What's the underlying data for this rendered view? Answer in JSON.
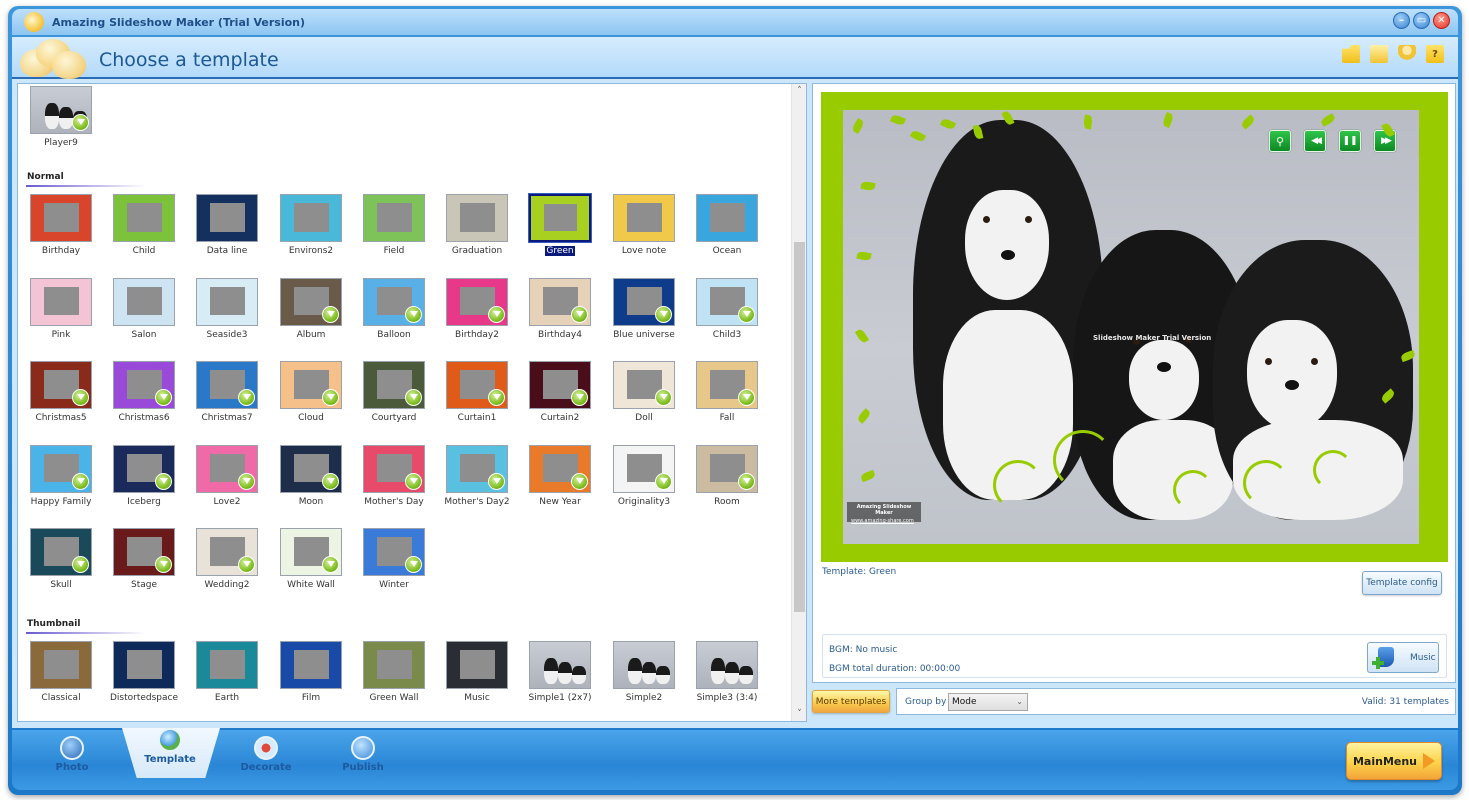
{
  "window": {
    "title": "Amazing Slideshow Maker (Trial Version)",
    "controls": {
      "minimize": "–",
      "maximize": "▭",
      "close": "✕"
    }
  },
  "header": {
    "title": "Choose a template",
    "tools": [
      {
        "name": "open-folder-icon",
        "glyph": ""
      },
      {
        "name": "save-icon",
        "glyph": ""
      },
      {
        "name": "user-icon",
        "glyph": ""
      },
      {
        "name": "help-icon",
        "glyph": "?"
      }
    ]
  },
  "templates": {
    "top": [
      {
        "label": "Player9",
        "style": "dogs",
        "download": true
      }
    ],
    "sections": [
      {
        "title": "Normal",
        "items": [
          {
            "label": "Birthday",
            "bg": "#d8452a",
            "download": false
          },
          {
            "label": "Child",
            "bg": "#7cc23a",
            "download": false
          },
          {
            "label": "Data line",
            "bg": "#14305e",
            "download": false
          },
          {
            "label": "Environs2",
            "bg": "#4ab8d8",
            "download": false
          },
          {
            "label": "Field",
            "bg": "#7ec25a",
            "download": false
          },
          {
            "label": "Graduation",
            "bg": "#c9c6b8",
            "download": false
          },
          {
            "label": "Green",
            "bg": "#a8d020",
            "download": false,
            "selected": true
          },
          {
            "label": "Love note",
            "bg": "#f0c84a",
            "download": false
          },
          {
            "label": "Ocean",
            "bg": "#3aa6de",
            "download": false
          },
          {
            "label": "Pink",
            "bg": "#f2c4d4",
            "download": false
          },
          {
            "label": "Salon",
            "bg": "#cfe4f2",
            "download": false
          },
          {
            "label": "Seaside3",
            "bg": "#d8ecf6",
            "download": false
          },
          {
            "label": "Album",
            "bg": "#6a5a4a",
            "download": true
          },
          {
            "label": "Balloon",
            "bg": "#58b0e6",
            "download": true
          },
          {
            "label": "Birthday2",
            "bg": "#e8388a",
            "download": true
          },
          {
            "label": "Birthday4",
            "bg": "#e6d2b8",
            "download": true
          },
          {
            "label": "Blue universe",
            "bg": "#0e3c8a",
            "download": true
          },
          {
            "label": "Child3",
            "bg": "#bfe2f4",
            "download": true
          },
          {
            "label": "Christmas5",
            "bg": "#8a2a1a",
            "download": true
          },
          {
            "label": "Christmas6",
            "bg": "#9a4ad8",
            "download": true
          },
          {
            "label": "Christmas7",
            "bg": "#2a78c8",
            "download": true
          },
          {
            "label": "Cloud",
            "bg": "#f6c08a",
            "download": true
          },
          {
            "label": "Courtyard",
            "bg": "#4a5a3a",
            "download": true
          },
          {
            "label": "Curtain1",
            "bg": "#e05a1a",
            "download": true
          },
          {
            "label": "Curtain2",
            "bg": "#4a0e1a",
            "download": true
          },
          {
            "label": "Doll",
            "bg": "#efe6d8",
            "download": true
          },
          {
            "label": "Fall",
            "bg": "#e8c88a",
            "download": true
          },
          {
            "label": "Happy Family",
            "bg": "#4ab4e8",
            "download": true
          },
          {
            "label": "Iceberg",
            "bg": "#1a2a5a",
            "download": true
          },
          {
            "label": "Love2",
            "bg": "#f06aa8",
            "download": true
          },
          {
            "label": "Moon",
            "bg": "#1e2e4a",
            "download": true
          },
          {
            "label": "Mother's Day",
            "bg": "#e84a6a",
            "download": true
          },
          {
            "label": "Mother's Day2",
            "bg": "#5ac0e0",
            "download": true
          },
          {
            "label": "New Year",
            "bg": "#e87a2a",
            "download": true
          },
          {
            "label": "Originality3",
            "bg": "#f4f4f4",
            "download": true
          },
          {
            "label": "Room",
            "bg": "#cbbba0",
            "download": true
          },
          {
            "label": "Skull",
            "bg": "#1a4a5a",
            "download": true
          },
          {
            "label": "Stage",
            "bg": "#6a1a1a",
            "download": true
          },
          {
            "label": "Wedding2",
            "bg": "#e8e2d8",
            "download": true
          },
          {
            "label": "White Wall",
            "bg": "#eef4e4",
            "download": true
          },
          {
            "label": "Winter",
            "bg": "#3a7ad8",
            "download": true
          }
        ]
      },
      {
        "title": "Thumbnail",
        "items": [
          {
            "label": "Classical",
            "bg": "#8a6a3a",
            "download": false
          },
          {
            "label": "Distortedspace",
            "bg": "#0e2a5a",
            "download": false
          },
          {
            "label": "Earth",
            "bg": "#1a8a9a",
            "download": false
          },
          {
            "label": "Film",
            "bg": "#1a4aa8",
            "download": false
          },
          {
            "label": "Green Wall",
            "bg": "#7a8a4a",
            "download": false
          },
          {
            "label": "Music",
            "bg": "#2a2e34",
            "download": false
          },
          {
            "label": "Simple1 (2x7)",
            "bg": "#ffffff",
            "download": false,
            "style": "dogs"
          },
          {
            "label": "Simple2",
            "bg": "#aab0c8",
            "download": false,
            "style": "dogs"
          },
          {
            "label": "Simple3 (3:4)",
            "bg": "#ffffff",
            "download": false,
            "style": "dogs"
          }
        ]
      }
    ]
  },
  "scrollbar": {
    "up": "˄",
    "down": "˅",
    "position_fraction": 0.25,
    "visible_fraction": 0.6
  },
  "preview": {
    "watermark_center": "Slideshow Maker Trial Version",
    "watermark_box_line1": "Amazing Slideshow Maker",
    "watermark_box_line2": "www.amazing-share.com",
    "controls": [
      {
        "name": "zoom-icon",
        "glyph": "⚲"
      },
      {
        "name": "rewind-icon",
        "glyph": "◀◀"
      },
      {
        "name": "pause-icon",
        "glyph": "❚❚"
      },
      {
        "name": "fast-forward-icon",
        "glyph": "▶▶"
      }
    ],
    "template_info": "Template:  Green",
    "template_config_label": "Template config",
    "bgm": "BGM: No music",
    "bgm_duration": "BGM total duration: 00:00:00",
    "music_label": "Music"
  },
  "footer": {
    "more_templates_label": "More templates",
    "group_by_label": "Group by",
    "group_by_value": "Mode",
    "group_by_chevron": "⌄",
    "valid_count": "Valid: 31 templates"
  },
  "bottom_tabs": [
    {
      "label": "Photo",
      "active": false,
      "color": "#2a6ab8"
    },
    {
      "label": "Template",
      "active": true,
      "color": "#5ab04a"
    },
    {
      "label": "Decorate",
      "active": false,
      "color": "#e04a3a"
    },
    {
      "label": "Publish",
      "active": false,
      "color": "#3a8ad8"
    }
  ],
  "main_menu_label": "MainMenu"
}
